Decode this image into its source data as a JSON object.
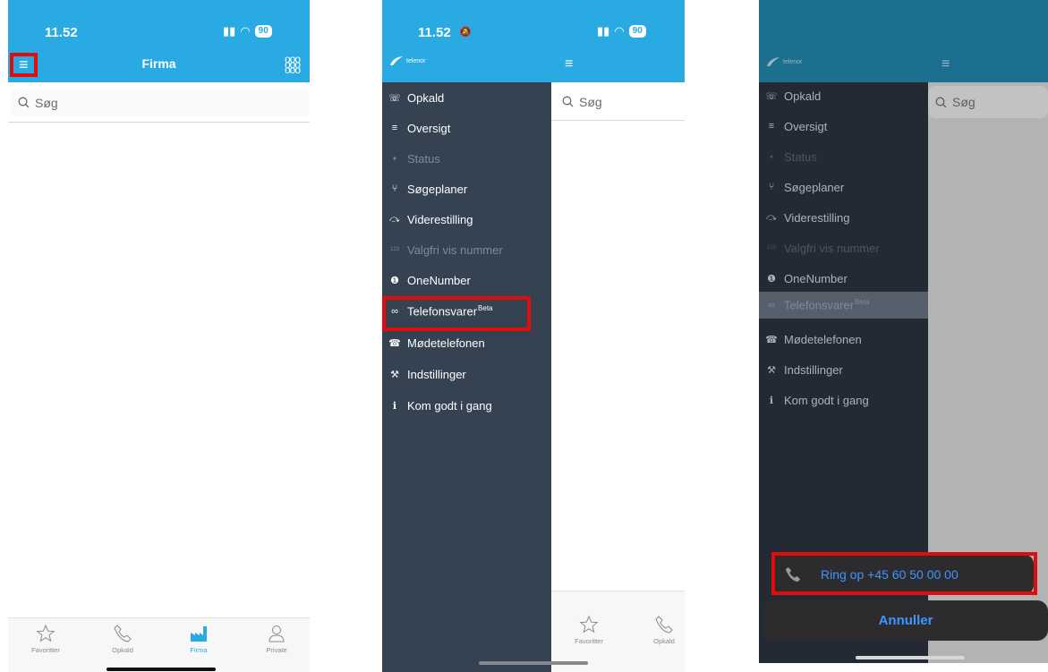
{
  "screen1": {
    "time": "11.52",
    "battery": "90",
    "title": "Firma",
    "search_placeholder": "Søg",
    "tabs": [
      {
        "label": "Favoritter"
      },
      {
        "label": "Opkald"
      },
      {
        "label": "Firma"
      },
      {
        "label": "Private"
      }
    ]
  },
  "screen2": {
    "time": "11.52",
    "battery": "90",
    "logo_text": "telenor",
    "search_placeholder": "Søg",
    "menu": [
      {
        "label": "Opkald",
        "icon": "phone-icon",
        "glyph": "☏"
      },
      {
        "label": "Oversigt",
        "icon": "list-icon",
        "glyph": "≡"
      },
      {
        "label": "Status",
        "icon": "dot-icon",
        "glyph": "●"
      },
      {
        "label": "Søgeplaner",
        "icon": "route-icon",
        "glyph": "⑂"
      },
      {
        "label": "Viderestilling",
        "icon": "forward-icon",
        "glyph": "⤼"
      },
      {
        "label": "Valgfri vis nummer",
        "icon": "numbers-icon",
        "glyph": "123"
      },
      {
        "label": "OneNumber",
        "icon": "one-icon",
        "glyph": "❶"
      },
      {
        "label": "Telefonsvarer",
        "badge": "Beta",
        "icon": "voicemail-icon",
        "glyph": "∞"
      },
      {
        "label": "Mødetelefonen",
        "icon": "meeting-phone-icon",
        "glyph": "☎"
      },
      {
        "label": "Indstillinger",
        "icon": "wrench-icon",
        "glyph": "⚒"
      },
      {
        "label": "Kom godt i gang",
        "icon": "info-icon",
        "glyph": "ℹ"
      }
    ],
    "tabs": [
      {
        "label": "Favoritter"
      },
      {
        "label": "Opkald"
      }
    ]
  },
  "screen3": {
    "logo_text": "telenor",
    "search_placeholder": "Søg",
    "call_action": "Ring op +45 60 50 00 00",
    "cancel": "Annuller"
  },
  "colors": {
    "header_blue": "#29aae3",
    "drawer_bg": "#354252",
    "highlight_red": "#e10d0d",
    "ios_blue": "#3e95ff"
  }
}
